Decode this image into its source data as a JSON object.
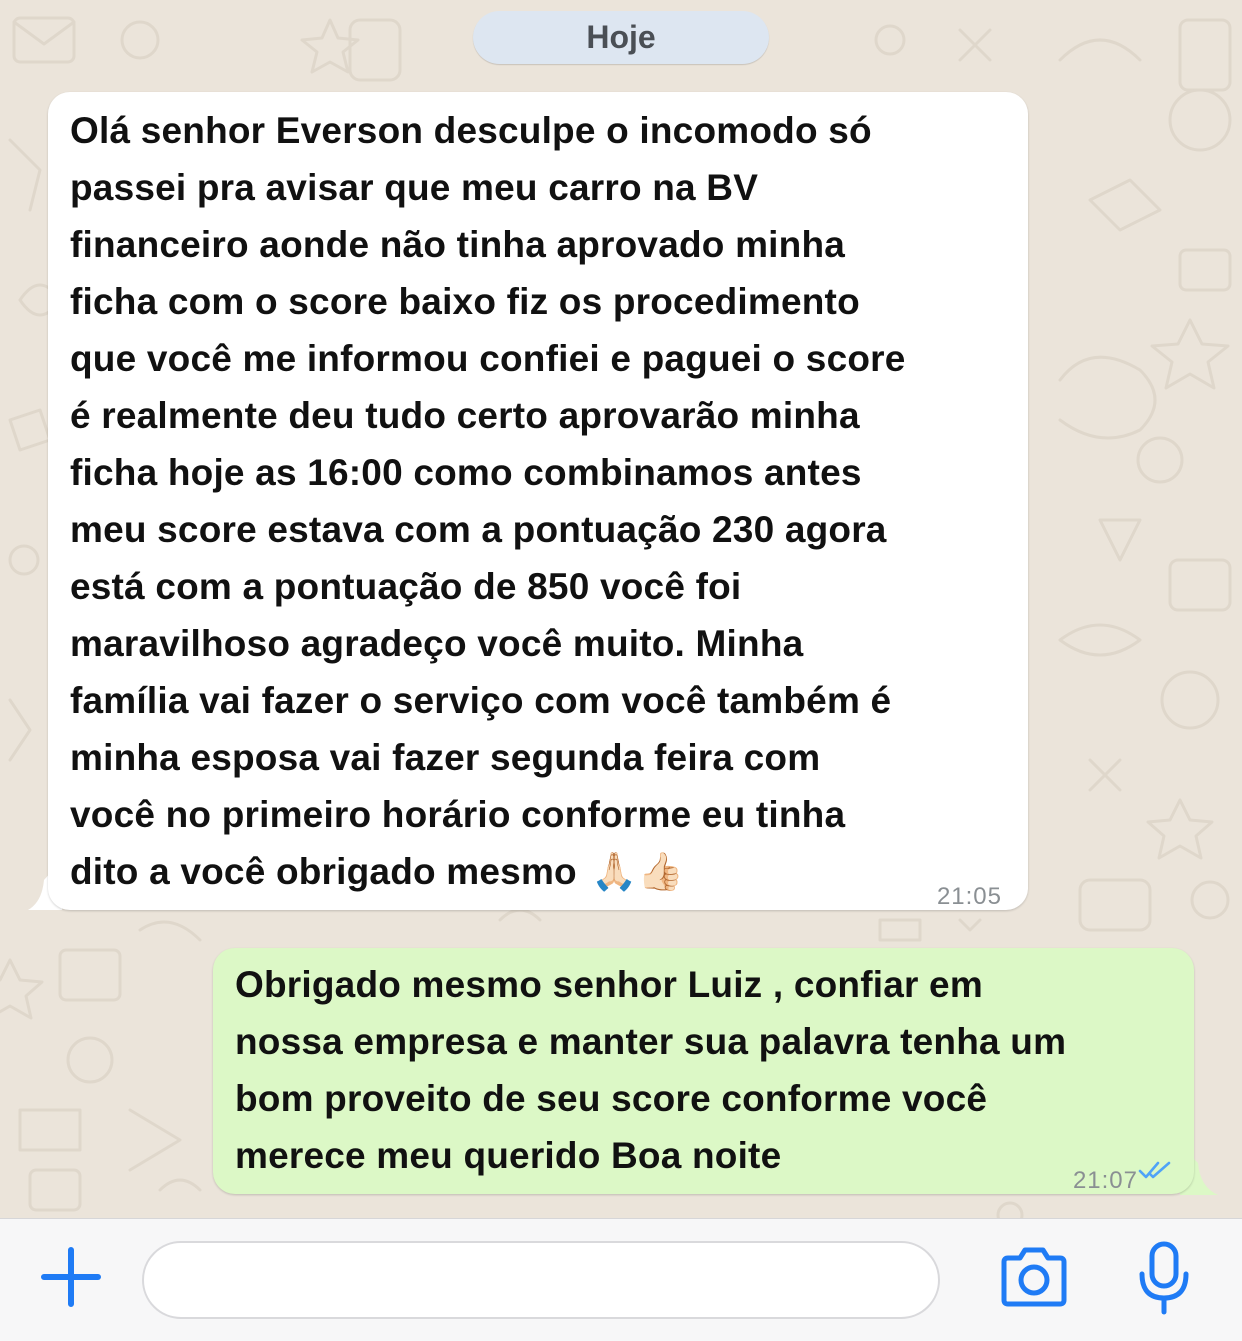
{
  "date_separator": {
    "label": "Hoje"
  },
  "messages": [
    {
      "direction": "incoming",
      "text": "Olá senhor Everson desculpe o incomodo só\npassei pra avisar que meu carro na BV\nfinanceiro aonde não tinha aprovado minha\nficha com o score baixo fiz os procedimento\nque você me informou confiei e paguei o score\né realmente deu tudo certo aprovarão minha\nficha hoje as 16:00 como combinamos antes\nmeu score estava com a pontuação 230 agora\nestá com a pontuação de 850 você foi\nmaravilhoso agradeço você muito. Minha\nfamília vai fazer o serviço com você também é\nminha esposa vai fazer segunda feira com\nvocê no primeiro horário conforme eu tinha\ndito a você obrigado mesmo",
      "emoji": "🙏🏻👍🏻",
      "time": "21:05"
    },
    {
      "direction": "outgoing",
      "text": "Obrigado mesmo senhor Luiz , confiar em\nnossa empresa e manter sua palavra tenha um\nbom proveito de seu score conforme você\nmerece meu querido Boa noite",
      "time": "21:07",
      "status": "read"
    }
  ],
  "composer": {
    "placeholder": "",
    "icons": [
      "plus-icon",
      "camera-icon",
      "microphone-icon"
    ]
  },
  "colors": {
    "accent": "#1f7bf5",
    "incoming_bubble": "#ffffff",
    "outgoing_bubble": "#dcf8c6",
    "read_ticks": "#4fa3f7",
    "chat_background": "#ebe4da",
    "date_pill": "#dde6f1"
  }
}
